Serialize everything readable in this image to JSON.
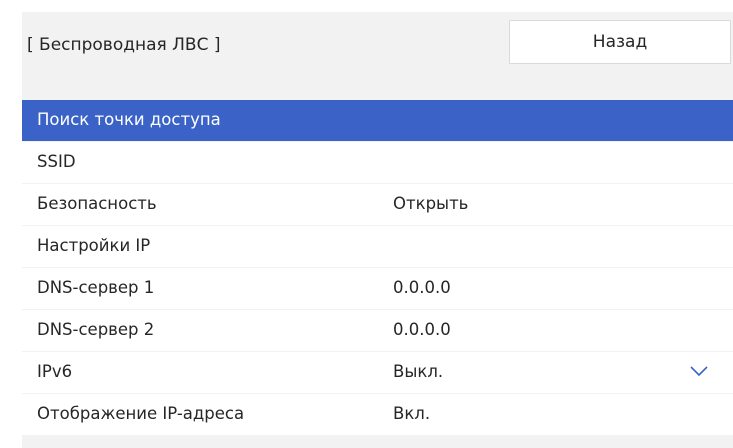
{
  "header": {
    "title": "[ Беспроводная ЛВС ]",
    "back_label": "Назад"
  },
  "menu": {
    "items": [
      {
        "label": "Поиск точки доступа",
        "value": "",
        "selected": true
      },
      {
        "label": "SSID",
        "value": ""
      },
      {
        "label": "Безопасность",
        "value": "Открыть"
      },
      {
        "label": "Настройки IP",
        "value": ""
      },
      {
        "label": "DNS-сервер 1",
        "value": "0.0.0.0"
      },
      {
        "label": "DNS-сервер 2",
        "value": "0.0.0.0"
      },
      {
        "label": "IPv6",
        "value": "Выкл.",
        "icon": "chevron-down-icon"
      },
      {
        "label": "Отображение IP-адреса",
        "value": "Вкл."
      }
    ]
  },
  "colors": {
    "accent": "#3b63c7",
    "background": "#f2f2f2",
    "row": "#ffffff",
    "text": "#262626"
  }
}
